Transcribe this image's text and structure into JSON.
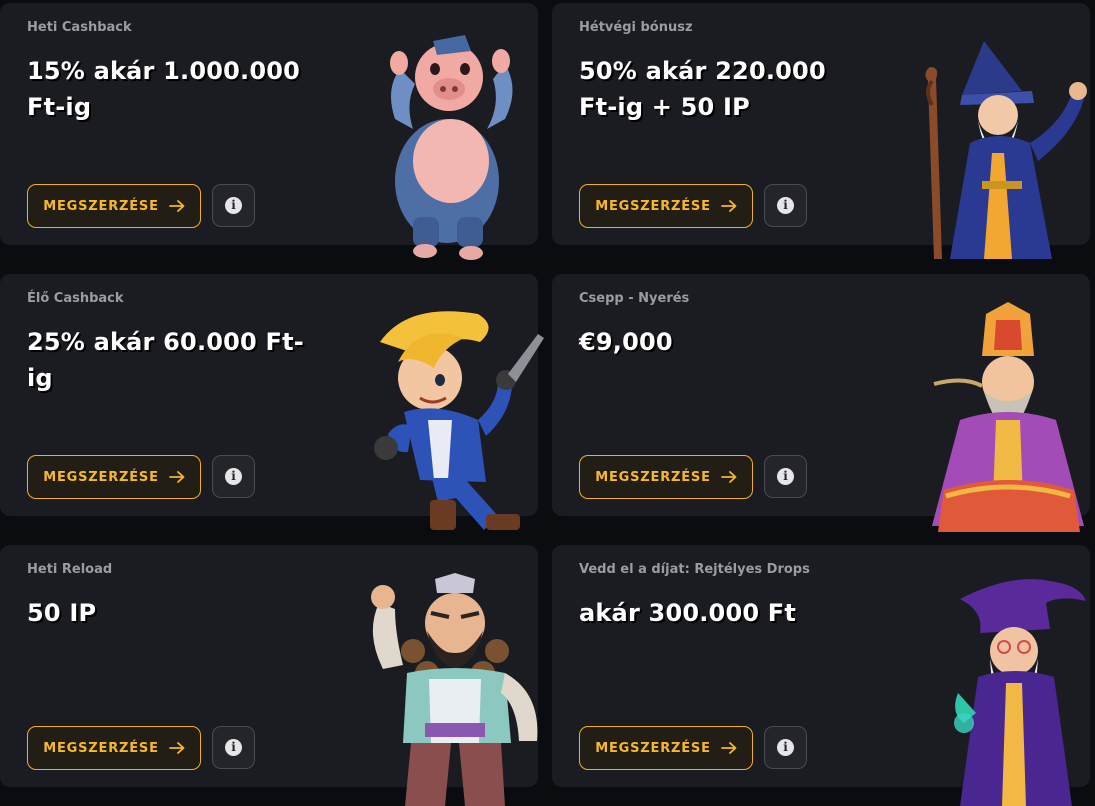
{
  "cards": [
    {
      "subtitle": "Heti Cashback",
      "title": "15% akár 1.000.000 Ft-ig",
      "button_label": "MEGSZERZÉSE",
      "mascot": "pig-character-illustration"
    },
    {
      "subtitle": "Hétvégi bónusz",
      "title": "50% akár 220.000 Ft-ig + 50 IP",
      "button_label": "MEGSZERZÉSE",
      "mascot": "wizard-character-illustration"
    },
    {
      "subtitle": "Élő Cashback",
      "title": "25% akár 60.000 Ft-ig",
      "button_label": "MEGSZERZÉSE",
      "mascot": "hero-boy-character-illustration"
    },
    {
      "subtitle": "Csepp - Nyerés",
      "title": "€9,000",
      "button_label": "MEGSZERZÉSE",
      "mascot": "monk-character-illustration"
    },
    {
      "subtitle": "Heti Reload",
      "title": "50 IP",
      "button_label": "MEGSZERZÉSE",
      "mascot": "warrior-character-illustration"
    },
    {
      "subtitle": "Vedd el a díjat: Rejtélyes Drops",
      "title": "akár 300.000 Ft",
      "button_label": "MEGSZERZÉSE",
      "mascot": "purple-wizard-character-illustration"
    }
  ],
  "colors": {
    "background": "#0b0c0f",
    "card": "#1b1c21",
    "accent": "#f2b01e",
    "text": "#ffffff",
    "muted": "#9b9ca3"
  },
  "icons": {
    "button_arrow": "arrow-right-icon",
    "info": "info-icon"
  }
}
